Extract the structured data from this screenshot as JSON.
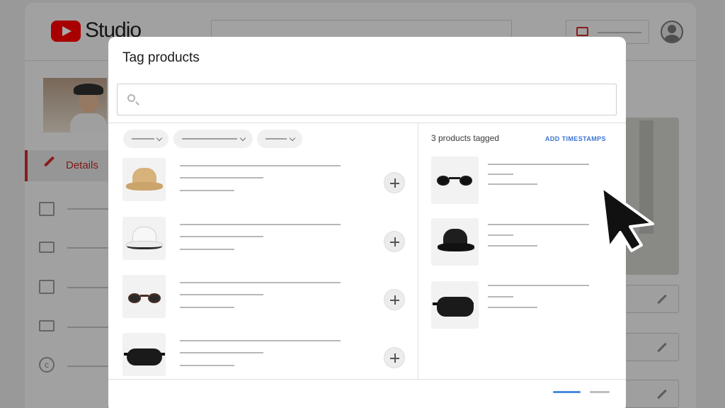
{
  "app": {
    "logo_text": "Studio"
  },
  "sidebar": {
    "active_item": {
      "label": "Details"
    }
  },
  "modal": {
    "title": "Tag products",
    "search": {
      "placeholder": "",
      "value": ""
    },
    "tagged_header": {
      "count_label": "3 products tagged",
      "add_timestamps_label": "ADD TIMESTAMPS"
    },
    "products": [
      {
        "icon": "bucket-hat-tan"
      },
      {
        "icon": "bucket-hat-white"
      },
      {
        "icon": "sunglasses-tortoise"
      },
      {
        "icon": "belt-bag-black"
      }
    ],
    "tagged_products": [
      {
        "icon": "sunglasses-black"
      },
      {
        "icon": "bucket-hat-black"
      },
      {
        "icon": "belt-bag-black"
      }
    ]
  },
  "colors": {
    "accent": "#ff0000",
    "link": "#3b73d3",
    "active_page": "#4c8ae0"
  }
}
